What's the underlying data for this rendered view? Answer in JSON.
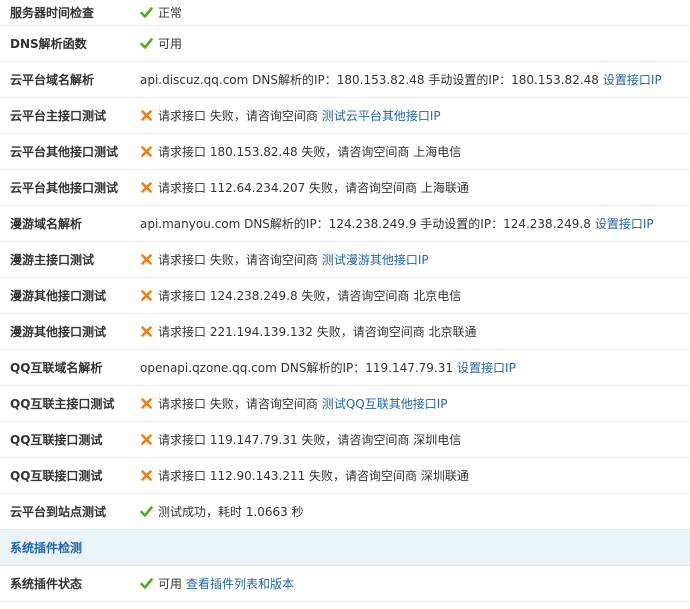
{
  "colors": {
    "ok": "#4caf17",
    "fail": "#f07d1a",
    "link": "#2366a8",
    "section_bg": "#eaf4f8"
  },
  "rows": [
    {
      "label": "服务器时间检查",
      "status": "ok",
      "text": "正常"
    },
    {
      "label": "DNS解析函数",
      "status": "ok",
      "text": "可用"
    },
    {
      "label": "云平台域名解析",
      "text": "api.discuz.qq.com DNS解析的IP：180.153.82.48 手动设置的IP：180.153.82.48",
      "link": "设置接口IP"
    },
    {
      "label": "云平台主接口测试",
      "status": "fail",
      "text": "请求接口 失败，请咨询空间商",
      "link": "测试云平台其他接口IP"
    },
    {
      "label": "云平台其他接口测试",
      "status": "fail",
      "text": "请求接口 180.153.82.48 失败，请咨询空间商 上海电信"
    },
    {
      "label": "云平台其他接口测试",
      "status": "fail",
      "text": "请求接口 112.64.234.207 失败，请咨询空间商 上海联通"
    },
    {
      "label": "漫游域名解析",
      "text": "api.manyou.com DNS解析的IP：124.238.249.9 手动设置的IP：124.238.249.8",
      "link": "设置接口IP"
    },
    {
      "label": "漫游主接口测试",
      "status": "fail",
      "text": "请求接口 失败，请咨询空间商",
      "link": "测试漫游其他接口IP"
    },
    {
      "label": "漫游其他接口测试",
      "status": "fail",
      "text": "请求接口 124.238.249.8 失败，请咨询空间商 北京电信"
    },
    {
      "label": "漫游其他接口测试",
      "status": "fail",
      "text": "请求接口 221.194.139.132 失败，请咨询空间商 北京联通"
    },
    {
      "label": "QQ互联域名解析",
      "text": "openapi.qzone.qq.com DNS解析的IP：119.147.79.31",
      "link": "设置接口IP"
    },
    {
      "label": "QQ互联主接口测试",
      "status": "fail",
      "text": "请求接口 失败，请咨询空间商",
      "link": "测试QQ互联其他接口IP"
    },
    {
      "label": "QQ互联接口测试",
      "status": "fail",
      "text": "请求接口 119.147.79.31 失败，请咨询空间商 深圳电信"
    },
    {
      "label": "QQ互联接口测试",
      "status": "fail",
      "text": "请求接口 112.90.143.211 失败，请咨询空间商 深圳联通"
    },
    {
      "label": "云平台到站点测试",
      "status": "ok",
      "text": "测试成功，耗时 1.0663 秒"
    }
  ],
  "section": {
    "title": "系统插件检测"
  },
  "plugin_rows": [
    {
      "label": "系统插件状态",
      "status": "ok",
      "text": "可用",
      "link": "查看插件列表和版本"
    }
  ]
}
